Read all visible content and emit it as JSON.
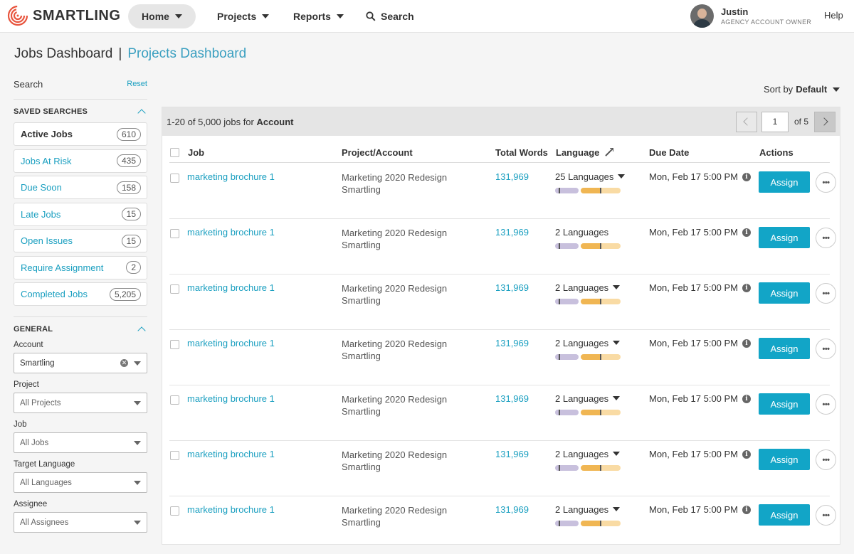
{
  "brand": {
    "name": "SMARTLING",
    "accent": "#1a9fc0",
    "button_color": "#12a5c7"
  },
  "nav": {
    "home": "Home",
    "projects": "Projects",
    "reports": "Reports",
    "search": "Search",
    "help": "Help"
  },
  "user": {
    "name": "Justin",
    "role": "AGENCY ACCOUNT OWNER"
  },
  "page": {
    "title": "Jobs Dashboard",
    "separator": "|",
    "alt_link": "Projects Dashboard"
  },
  "sidebar": {
    "search_label": "Search",
    "reset_label": "Reset",
    "saved_title": "SAVED SEARCHES",
    "saved_items": [
      {
        "label": "Active Jobs",
        "count": "610"
      },
      {
        "label": "Jobs At Risk",
        "count": "435"
      },
      {
        "label": "Due Soon",
        "count": "158"
      },
      {
        "label": "Late Jobs",
        "count": "15"
      },
      {
        "label": "Open Issues",
        "count": "15"
      },
      {
        "label": "Require Assignment",
        "count": "2"
      },
      {
        "label": "Completed Jobs",
        "count": "5,205"
      }
    ],
    "general_title": "GENERAL",
    "filters": [
      {
        "label": "Account",
        "value": "Smartling"
      },
      {
        "label": "Project",
        "value": "All Projects"
      },
      {
        "label": "Job",
        "value": "All Jobs"
      },
      {
        "label": "Target Language",
        "value": "All Languages"
      },
      {
        "label": "Assignee",
        "value": "All Assignees"
      }
    ]
  },
  "sort": {
    "label": "Sort by",
    "value": "Default"
  },
  "results": {
    "range": "1-20 of 5,000 jobs for",
    "scope": "Account",
    "page": "1",
    "of_pages": "of 5"
  },
  "table": {
    "headers": {
      "job": "Job",
      "project": "Project/Account",
      "words": "Total Words",
      "language": "Language",
      "due": "Due Date",
      "actions": "Actions"
    },
    "assign_label": "Assign",
    "more_label": "•••",
    "rows": [
      {
        "job": "marketing brochure 1",
        "project": "Marketing 2020 Redesign",
        "account": "Smartling",
        "words": "131,969",
        "languages": "25 Languages",
        "due": "Mon, Feb 17 5:00 PM"
      },
      {
        "job": "marketing brochure 1",
        "project": "Marketing 2020 Redesign",
        "account": "Smartling",
        "words": "131,969",
        "languages": "2 Languages",
        "due": "Mon, Feb 17 5:00 PM"
      },
      {
        "job": "marketing brochure 1",
        "project": "Marketing 2020 Redesign",
        "account": "Smartling",
        "words": "131,969",
        "languages": "2 Languages",
        "due": "Mon, Feb 17 5:00 PM"
      },
      {
        "job": "marketing brochure 1",
        "project": "Marketing 2020 Redesign",
        "account": "Smartling",
        "words": "131,969",
        "languages": "2 Languages",
        "due": "Mon, Feb 17 5:00 PM"
      },
      {
        "job": "marketing brochure 1",
        "project": "Marketing 2020 Redesign",
        "account": "Smartling",
        "words": "131,969",
        "languages": "2 Languages",
        "due": "Mon, Feb 17 5:00 PM"
      },
      {
        "job": "marketing brochure 1",
        "project": "Marketing 2020 Redesign",
        "account": "Smartling",
        "words": "131,969",
        "languages": "2 Languages",
        "due": "Mon, Feb 17 5:00 PM"
      },
      {
        "job": "marketing brochure 1",
        "project": "Marketing 2020 Redesign",
        "account": "Smartling",
        "words": "131,969",
        "languages": "2 Languages",
        "due": "Mon, Feb 17 5:00 PM"
      }
    ]
  }
}
